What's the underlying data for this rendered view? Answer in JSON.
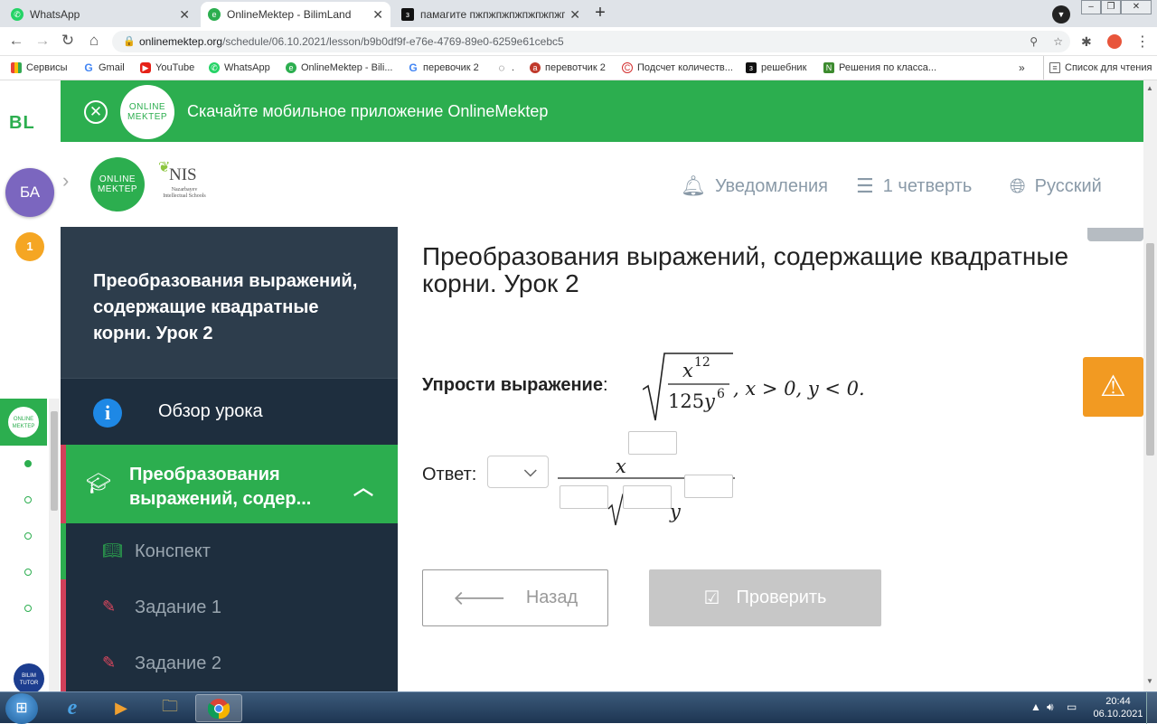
{
  "browser": {
    "tabs": [
      {
        "label": "WhatsApp",
        "icon": "whatsapp-icon",
        "active": false
      },
      {
        "label": "OnlineMektep - BilimLand",
        "icon": "onlinemektep-icon",
        "active": true
      },
      {
        "label": "памагите пжпжпжпжпжпжпжпжпжп",
        "icon": "znanija-icon",
        "active": false
      }
    ],
    "url_domain": "onlinemektep.org",
    "url_path": "/schedule/06.10.2021/lesson/b9b0df9f-e76e-4769-89e0-6259e61cebc5",
    "bookmarks": [
      "Сервисы",
      "Gmail",
      "YouTube",
      "WhatsApp",
      "OnlineMektep - Bili...",
      "перевочик 2",
      ".",
      "перевотчик 2",
      "Подсчет количеств...",
      "решебник",
      "Решения по класса...",
      "»",
      "Список для чтения"
    ]
  },
  "rail": {
    "logo": "BL",
    "avatar_initials": "БА",
    "notifications_count": "1",
    "tutor_logo": "BILIM TUTOR"
  },
  "banner": {
    "logo": "ONLINE MEKTEP",
    "text": "Скачайте мобильное приложение OnlineMektep"
  },
  "header": {
    "logo": "ONLINE MEKTEP",
    "nis_name": "NIS",
    "nis_full": "Nazarbayev Intellectual Schools",
    "notifications": "Уведомления",
    "quarter": "1 четверть",
    "language": "Русский"
  },
  "sidebar": {
    "lesson_title": "Преобразования выражений, содержащие квадратные корни. Урок 2",
    "overview": "Обзор урока",
    "section": "Преобразования выражений, содер...",
    "items": [
      {
        "label": "Конспект",
        "type": "notes"
      },
      {
        "label": "Задание 1",
        "type": "task"
      },
      {
        "label": "Задание 2",
        "type": "task"
      }
    ]
  },
  "main": {
    "title": "Преобразования выражений, содержащие квадратные корни. Урок 2",
    "task_label": "Упрости выражение",
    "task_colon": ":",
    "math": {
      "numerator_var": "x",
      "numerator_exp": "12",
      "denominator_coef": "125",
      "denominator_var": "y",
      "denominator_exp": "6",
      "condition": ", x > 0, y < 0."
    },
    "answer_label": "Ответ:",
    "answer_numerator_var": "x",
    "answer_denominator_var": "y",
    "back_button": "Назад",
    "check_button": "Проверить"
  },
  "taskbar": {
    "time": "20:44",
    "date": "06.10.2021"
  }
}
